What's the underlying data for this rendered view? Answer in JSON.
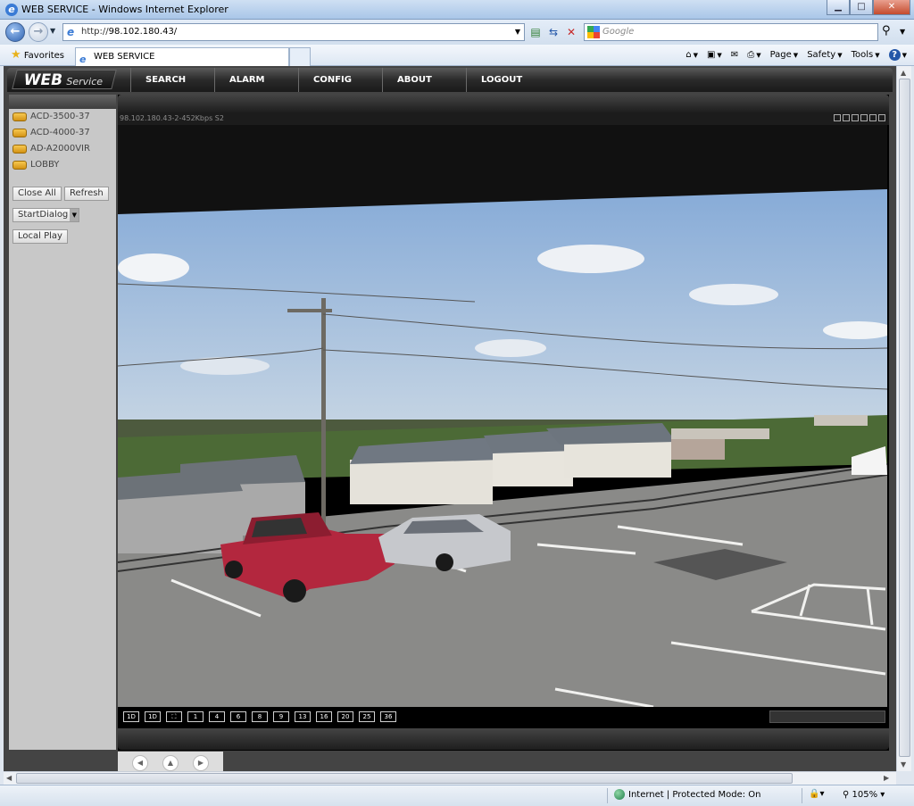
{
  "window": {
    "title": "WEB SERVICE - Windows Internet Explorer",
    "min": "▁",
    "max": "□",
    "close": "✕"
  },
  "browser": {
    "url_prefix": "http://",
    "url_host": "98.102.180.43/",
    "search_placeholder": "Google",
    "favorites_label": "Favorites",
    "tab_title": "WEB SERVICE",
    "commands": {
      "page": "Page",
      "safety": "Safety",
      "tools": "Tools",
      "help": "?"
    }
  },
  "app": {
    "logo_web": "WEB",
    "logo_service": "Service",
    "menu": [
      "SEARCH",
      "ALARM",
      "CONFIG",
      "ABOUT",
      "LOGOUT"
    ],
    "devices": [
      "ACD-3500-37",
      "ACD-4000-37",
      "AD-A2000VIR",
      "LOBBY"
    ],
    "buttons": {
      "close_all": "Close All",
      "refresh": "Refresh",
      "start_dialog": "StartDialog",
      "local_play": "Local Play"
    },
    "video_info": "98.102.180.43-2-452Kbps S2",
    "layout_buttons": [
      "1D",
      "1D",
      "⛶",
      "1",
      "4",
      "6",
      "8",
      "9",
      "13",
      "16",
      "20",
      "25",
      "36"
    ]
  },
  "status": {
    "zone": "Internet | Protected Mode: On",
    "zoom": "105%"
  }
}
